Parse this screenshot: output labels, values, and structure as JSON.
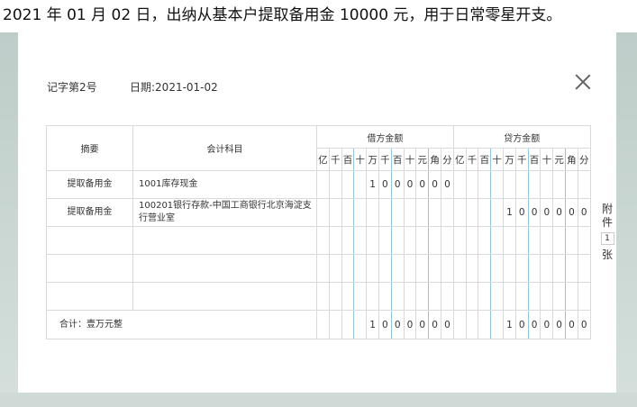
{
  "task_text": "2021 年 01 月 02 日，出纳从基本户提取备用金 10000 元，用于日常零星开支。",
  "voucher": {
    "number_label": "记字第2号",
    "date_label": "日期:2021-01-02"
  },
  "table": {
    "col_summary": "摘要",
    "col_account": "会计科目",
    "debit_header": "借方金额",
    "credit_header": "贷方金额",
    "units": [
      "亿",
      "千",
      "百",
      "十",
      "万",
      "千",
      "百",
      "十",
      "元",
      "角",
      "分"
    ],
    "rows": [
      {
        "summary": "提取备用金",
        "account": "1001库存现金",
        "debit": [
          "",
          "",
          "",
          "",
          "1",
          "0",
          "0",
          "0",
          "0",
          "0",
          "0"
        ],
        "credit": [
          "",
          "",
          "",
          "",
          "",
          "",
          "",
          "",
          "",
          "",
          ""
        ]
      },
      {
        "summary": "提取备用金",
        "account": "100201银行存款-中国工商银行北京海淀支行营业室",
        "debit": [
          "",
          "",
          "",
          "",
          "",
          "",
          "",
          "",
          "",
          "",
          ""
        ],
        "credit": [
          "",
          "",
          "",
          "",
          "1",
          "0",
          "0",
          "0",
          "0",
          "0",
          "0"
        ]
      },
      {
        "summary": "",
        "account": "",
        "debit": [
          "",
          "",
          "",
          "",
          "",
          "",
          "",
          "",
          "",
          "",
          ""
        ],
        "credit": [
          "",
          "",
          "",
          "",
          "",
          "",
          "",
          "",
          "",
          "",
          ""
        ]
      },
      {
        "summary": "",
        "account": "",
        "debit": [
          "",
          "",
          "",
          "",
          "",
          "",
          "",
          "",
          "",
          "",
          ""
        ],
        "credit": [
          "",
          "",
          "",
          "",
          "",
          "",
          "",
          "",
          "",
          "",
          ""
        ]
      },
      {
        "summary": "",
        "account": "",
        "debit": [
          "",
          "",
          "",
          "",
          "",
          "",
          "",
          "",
          "",
          "",
          ""
        ],
        "credit": [
          "",
          "",
          "",
          "",
          "",
          "",
          "",
          "",
          "",
          "",
          ""
        ]
      }
    ],
    "total_label": "合计：壹万元整",
    "total_debit": [
      "",
      "",
      "",
      "",
      "1",
      "0",
      "0",
      "0",
      "0",
      "0",
      "0"
    ],
    "total_credit": [
      "",
      "",
      "",
      "",
      "1",
      "0",
      "0",
      "0",
      "0",
      "0",
      "0"
    ]
  },
  "attachment": {
    "label_top": [
      "附",
      "件"
    ],
    "count": "1",
    "label_bottom": "张"
  }
}
